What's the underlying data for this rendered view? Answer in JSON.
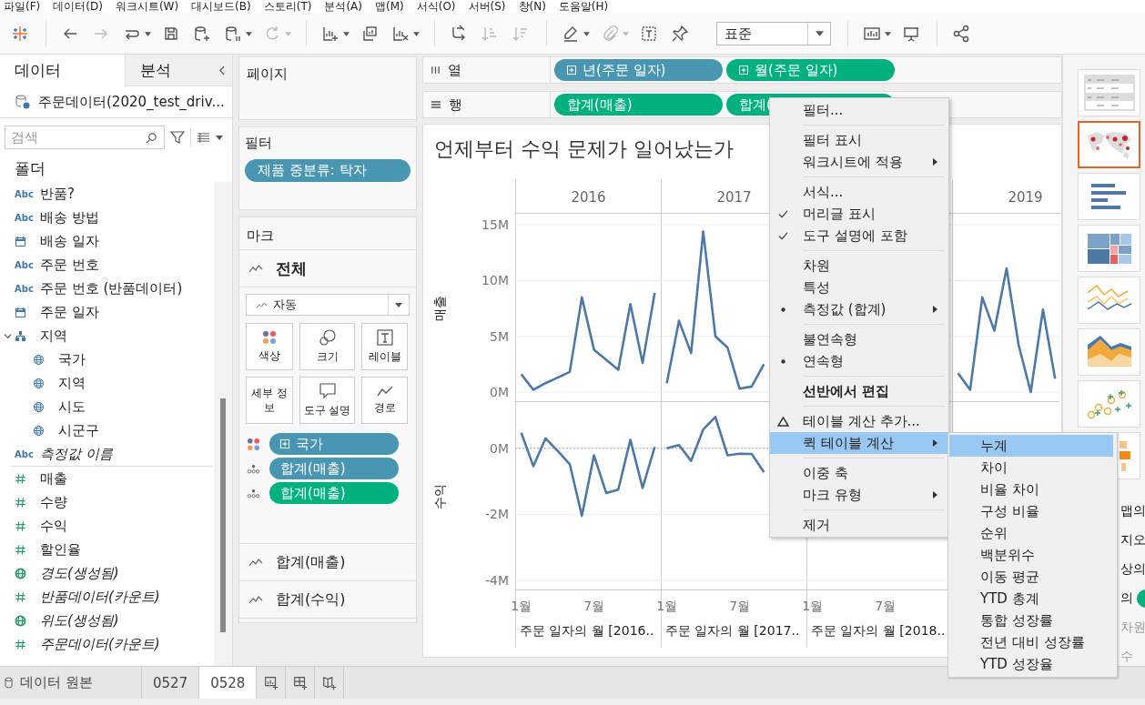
{
  "menubar": [
    "파일(F)",
    "데이터(D)",
    "워크시트(W)",
    "대시보드(B)",
    "스토리(T)",
    "분석(A)",
    "맵(M)",
    "서식(O)",
    "서버(S)",
    "창(N)",
    "도움말(H)"
  ],
  "toolbar": [
    {
      "kind": "logo",
      "dropdown": false
    },
    {
      "kind": "separator"
    },
    {
      "kind": "back",
      "disabled": false,
      "dropdown": false
    },
    {
      "kind": "forward",
      "disabled": true,
      "dropdown": false
    },
    {
      "kind": "redo",
      "disabled": false,
      "dropdown": true
    },
    {
      "kind": "save",
      "disabled": false,
      "dropdown": false
    },
    {
      "kind": "datasource",
      "disabled": false,
      "dropdown": false
    },
    {
      "kind": "pause",
      "disabled": false,
      "dropdown": true
    },
    {
      "kind": "refresh",
      "disabled": true,
      "dropdown": true
    },
    {
      "kind": "separator"
    },
    {
      "kind": "sheet",
      "disabled": false,
      "dropdown": true
    },
    {
      "kind": "duplicate",
      "disabled": false,
      "dropdown": false
    },
    {
      "kind": "clear",
      "disabled": false,
      "dropdown": true
    },
    {
      "kind": "separator"
    },
    {
      "kind": "swap",
      "disabled": false,
      "dropdown": false
    },
    {
      "kind": "sort-asc",
      "disabled": true,
      "dropdown": false
    },
    {
      "kind": "sort-desc",
      "disabled": true,
      "dropdown": false
    },
    {
      "kind": "separator"
    },
    {
      "kind": "highlight",
      "disabled": false,
      "dropdown": true
    },
    {
      "kind": "attach",
      "disabled": true,
      "dropdown": true
    },
    {
      "kind": "textbox",
      "disabled": false,
      "dropdown": false
    },
    {
      "kind": "pin",
      "disabled": false,
      "dropdown": false
    },
    {
      "kind": "fit",
      "value": "표준"
    },
    {
      "kind": "separator"
    },
    {
      "kind": "showme",
      "disabled": false,
      "dropdown": true
    },
    {
      "kind": "present",
      "disabled": false,
      "dropdown": false
    },
    {
      "kind": "separator"
    },
    {
      "kind": "share",
      "disabled": false,
      "dropdown": false
    }
  ],
  "data_pane": {
    "tabs": [
      {
        "label": "데이터",
        "selected": true
      },
      {
        "label": "분석",
        "selected": false
      }
    ],
    "source": "주문데이터(2020_test_driv...",
    "search": {
      "placeholder": "검색"
    },
    "folder_header": "폴더",
    "fields": [
      {
        "label": "반품?",
        "kind": "string",
        "type_text": "Abc",
        "color": "#3d78a6",
        "italic": false
      },
      {
        "label": "배송 방법",
        "kind": "string",
        "type_text": "Abc",
        "color": "#3d78a6",
        "italic": false
      },
      {
        "label": "배송 일자",
        "kind": "date",
        "color": "#3d78a6",
        "italic": false
      },
      {
        "label": "주문 번호",
        "kind": "string",
        "type_text": "Abc",
        "color": "#3d78a6",
        "italic": false
      },
      {
        "label": "주문 번호 (반품데이터)",
        "kind": "string",
        "type_text": "Abc",
        "color": "#3d78a6",
        "italic": false
      },
      {
        "label": "주문 일자",
        "kind": "date",
        "color": "#3d78a6",
        "italic": false
      },
      {
        "label": "지역",
        "kind": "hierarchy",
        "color": "#3d78a6",
        "italic": false,
        "expanded": true,
        "children": [
          {
            "label": "국가",
            "kind": "geo",
            "color": "#3d78a6",
            "italic": false
          },
          {
            "label": "지역",
            "kind": "geo",
            "color": "#3d78a6",
            "italic": false
          },
          {
            "label": "시도",
            "kind": "geo",
            "color": "#3d78a6",
            "italic": false
          },
          {
            "label": "시군구",
            "kind": "geo",
            "color": "#3d78a6",
            "italic": false
          }
        ]
      },
      {
        "label": "측정값 이름",
        "kind": "string",
        "type_text": "Abc",
        "color": "#3d78a6",
        "italic": true
      },
      {
        "label": "매출",
        "kind": "number",
        "color": "#2b9a6a",
        "italic": false
      },
      {
        "label": "수량",
        "kind": "number",
        "color": "#2b9a6a",
        "italic": false
      },
      {
        "label": "수익",
        "kind": "number",
        "color": "#2b9a6a",
        "italic": false
      },
      {
        "label": "할인율",
        "kind": "number",
        "color": "#2b9a6a",
        "italic": false
      },
      {
        "label": "경도(생성됨)",
        "kind": "geo",
        "color": "#2b9a6a",
        "italic": true
      },
      {
        "label": "반품데이터(카운트)",
        "kind": "number",
        "color": "#2b9a6a",
        "italic": true
      },
      {
        "label": "위도(생성됨)",
        "kind": "geo",
        "color": "#2b9a6a",
        "italic": true
      },
      {
        "label": "주문데이터(카운트)",
        "kind": "number",
        "color": "#2b9a6a",
        "italic": true
      }
    ]
  },
  "pages_card": {
    "title": "페이지"
  },
  "filters_card": {
    "title": "필터",
    "pills": [
      {
        "label": "제품 중분류: 탁자",
        "color": "#4996b2"
      }
    ]
  },
  "marks_card": {
    "title": "마크",
    "tabs": [
      {
        "label": "전체",
        "selected": true
      },
      {
        "label": "합계(매출)",
        "selected": false
      },
      {
        "label": "합계(수익)",
        "selected": false
      }
    ],
    "mark_type": "자동",
    "buttons": [
      {
        "label": "색상",
        "kind": "color"
      },
      {
        "label": "크기",
        "kind": "size"
      },
      {
        "label": "레이블",
        "kind": "label"
      },
      {
        "label": "세부 정보",
        "kind": "detail"
      },
      {
        "label": "도구 설명",
        "kind": "tooltip"
      },
      {
        "label": "경로",
        "kind": "path"
      }
    ],
    "pills": [
      {
        "label": "국가",
        "kind": "color",
        "color": "#4996b2",
        "expandable": true
      },
      {
        "label": "합계(매출)",
        "kind": "detail",
        "color": "#4996b2",
        "expandable": false
      },
      {
        "label": "합계(매출)",
        "kind": "detail",
        "color": "#00b180",
        "expandable": false
      }
    ]
  },
  "columns_shelf": {
    "label": "열",
    "pills": [
      {
        "label": "년(주문 일자)",
        "color": "#4996b2",
        "expandable": true
      },
      {
        "label": "월(주문 일자)",
        "color": "#00b180",
        "expandable": true
      }
    ]
  },
  "rows_shelf": {
    "label": "행",
    "pills": [
      {
        "label": "합계(매출)",
        "color": "#00b180",
        "expandable": false
      },
      {
        "label": "합계(",
        "color": "#00b180",
        "expandable": false
      }
    ]
  },
  "viz": {
    "title": "언제부터 수익 문제가 일어났는가",
    "panes": [
      {
        "year": "2016",
        "footer": "주문 일자의 월 [2016.."
      },
      {
        "year": "2017",
        "ticks": [
          "1월",
          "7월"
        ],
        "footer": "주문 일자의 월 [2017.."
      },
      {
        "ticks": [
          "1월",
          "7월"
        ],
        "footer": "주문 일자의 월 [2018.."
      },
      {
        "year": "2019"
      }
    ],
    "rows": [
      {
        "chart_data": {
          "type": "line",
          "ylabel": "매출",
          "grid": true,
          "x": [
            1,
            2,
            3,
            4,
            5,
            6,
            7,
            8,
            9,
            10,
            11,
            12,
            13,
            14,
            15,
            16,
            17,
            18,
            19,
            20,
            21,
            22,
            23,
            24,
            25,
            26,
            27,
            28,
            29,
            30,
            31,
            32,
            33,
            34,
            35,
            36,
            37,
            38,
            39,
            40,
            41,
            42,
            43,
            44,
            45
          ],
          "xlim": [
            0.5,
            45.36
          ],
          "ylim": [
            -0.9,
            16
          ],
          "yticks": [
            {
              "value": 0,
              "label": "0M"
            },
            {
              "value": 5,
              "label": "5M"
            },
            {
              "value": 10,
              "label": "10M"
            },
            {
              "value": 15,
              "label": "15M"
            }
          ],
          "series": [
            {
              "color": "#4e79a7",
              "values": [
                1.6,
                0.2,
                0.8,
                1.3,
                1.8,
                8.5,
                3.8,
                2.9,
                2.0,
                7.9,
                2.6,
                8.9,
                0.8,
                6.4,
                3.5,
                14.4,
                5.0,
                4.0,
                0.3,
                0.5,
                2.5,
                null,
                null,
                null,
                null,
                null,
                null,
                null,
                null,
                null,
                null,
                null,
                null,
                null,
                null,
                null,
                1.7,
                0.2,
                8.5,
                5.5,
                11.1,
                4.2,
                0.0,
                7.4,
                1.2
              ]
            }
          ]
        }
      },
      {
        "chart_data": {
          "type": "line",
          "ylabel": "수익",
          "grid": true,
          "x": [
            1,
            2,
            3,
            4,
            5,
            6,
            7,
            8,
            9,
            10,
            11,
            12,
            13,
            14,
            15,
            16,
            17,
            18,
            19,
            20,
            21
          ],
          "xlim": [
            0.5,
            45.36
          ],
          "ylim": [
            -4.3,
            1.4
          ],
          "xticks": [
            {
              "value": 1,
              "label": "1월"
            },
            {
              "value": 7,
              "label": "7월"
            }
          ],
          "yticks": [
            {
              "value": 0,
              "label": "0M"
            },
            {
              "value": -2,
              "label": "-2M"
            },
            {
              "value": -4,
              "label": "-4M"
            }
          ],
          "ref_lines": [
            {
              "axis": "y",
              "value": 0
            }
          ],
          "series": [
            {
              "color": "#4e79a7",
              "values": [
                0.47,
                -0.54,
                0.3,
                -0.08,
                -0.48,
                -2.04,
                -0.21,
                -1.35,
                -1.25,
                0.26,
                -1.2,
                0.04,
                0.0,
                0.1,
                -0.38,
                0.57,
                0.95,
                -0.21,
                -0.16,
                -0.17,
                -0.72
              ]
            }
          ]
        }
      }
    ]
  },
  "show_me": [
    {
      "kind": "table",
      "selected": false
    },
    {
      "kind": "map",
      "selected": true
    },
    {
      "kind": "bar",
      "selected": false
    },
    {
      "kind": "treemap",
      "selected": false
    },
    {
      "kind": "line",
      "selected": false
    },
    {
      "kind": "area",
      "selected": false
    },
    {
      "kind": "scatter",
      "selected": false
    },
    {
      "kind": "bullet",
      "selected": false
    }
  ],
  "show_me_text": [
    {
      "text": "맵의",
      "kind": "plain"
    },
    {
      "text": "지오",
      "kind": "plain"
    },
    {
      "text": "상의",
      "kind": "plain"
    },
    {
      "text": "의",
      "kind": "pill"
    },
    {
      "text": "차원",
      "kind": "muted"
    },
    {
      "text": "수",
      "kind": "muted"
    }
  ],
  "context_menu": {
    "groups": [
      [
        {
          "label": "필터...",
          "kind": "action",
          "submenu": false,
          "highlighted": false
        }
      ],
      [
        {
          "label": "필터 표시",
          "kind": "action",
          "submenu": false,
          "highlighted": false
        },
        {
          "label": "워크시트에 적용",
          "kind": "action",
          "submenu": true,
          "highlighted": false
        }
      ],
      [
        {
          "label": "서식...",
          "kind": "action",
          "submenu": false,
          "highlighted": false
        },
        {
          "label": "머리글 표시",
          "kind": "check",
          "checked": true,
          "submenu": false,
          "highlighted": false
        },
        {
          "label": "도구 설명에 포함",
          "kind": "check",
          "checked": true,
          "submenu": false,
          "highlighted": false
        }
      ],
      [
        {
          "label": "차원",
          "kind": "radio",
          "checked": false,
          "submenu": false,
          "highlighted": false
        },
        {
          "label": "특성",
          "kind": "radio",
          "checked": false,
          "submenu": false,
          "highlighted": false
        },
        {
          "label": "측정값 (합계)",
          "kind": "radio",
          "checked": true,
          "submenu": true,
          "highlighted": false
        }
      ],
      [
        {
          "label": "불연속형",
          "kind": "radio",
          "checked": false,
          "submenu": false,
          "highlighted": false
        },
        {
          "label": "연속형",
          "kind": "radio",
          "checked": true,
          "submenu": false,
          "highlighted": false
        }
      ],
      [
        {
          "label": "선반에서 편집",
          "kind": "default",
          "submenu": false,
          "highlighted": false
        }
      ],
      [
        {
          "label": "테이블 계산 추가...",
          "kind": "calc",
          "submenu": false,
          "highlighted": false
        },
        {
          "label": "퀵 테이블 계산",
          "kind": "action",
          "submenu": true,
          "highlighted": true
        }
      ],
      [
        {
          "label": "이중 축",
          "kind": "action",
          "submenu": false,
          "highlighted": false
        },
        {
          "label": "마크 유형",
          "kind": "action",
          "submenu": true,
          "highlighted": false
        }
      ],
      [
        {
          "label": "제거",
          "kind": "action",
          "submenu": false,
          "highlighted": false
        }
      ]
    ],
    "submenu": [
      {
        "label": "누계",
        "highlighted": true
      },
      {
        "label": "차이",
        "highlighted": false
      },
      {
        "label": "비율 차이",
        "highlighted": false
      },
      {
        "label": "구성 비율",
        "highlighted": false
      },
      {
        "label": "순위",
        "highlighted": false
      },
      {
        "label": "백분위수",
        "highlighted": false
      },
      {
        "label": "이동 평균",
        "highlighted": false
      },
      {
        "label": "YTD 총계",
        "highlighted": false
      },
      {
        "label": "통합 성장률",
        "highlighted": false
      },
      {
        "label": "전년 대비 성장률",
        "highlighted": false
      },
      {
        "label": "YTD 성장율",
        "highlighted": false
      }
    ]
  },
  "sheet_tabs": [
    {
      "label": "데이터 원본",
      "kind": "datasource",
      "selected": false
    },
    {
      "label": "0527",
      "kind": "sheet",
      "selected": false
    },
    {
      "label": "0528",
      "kind": "sheet",
      "selected": true
    }
  ]
}
